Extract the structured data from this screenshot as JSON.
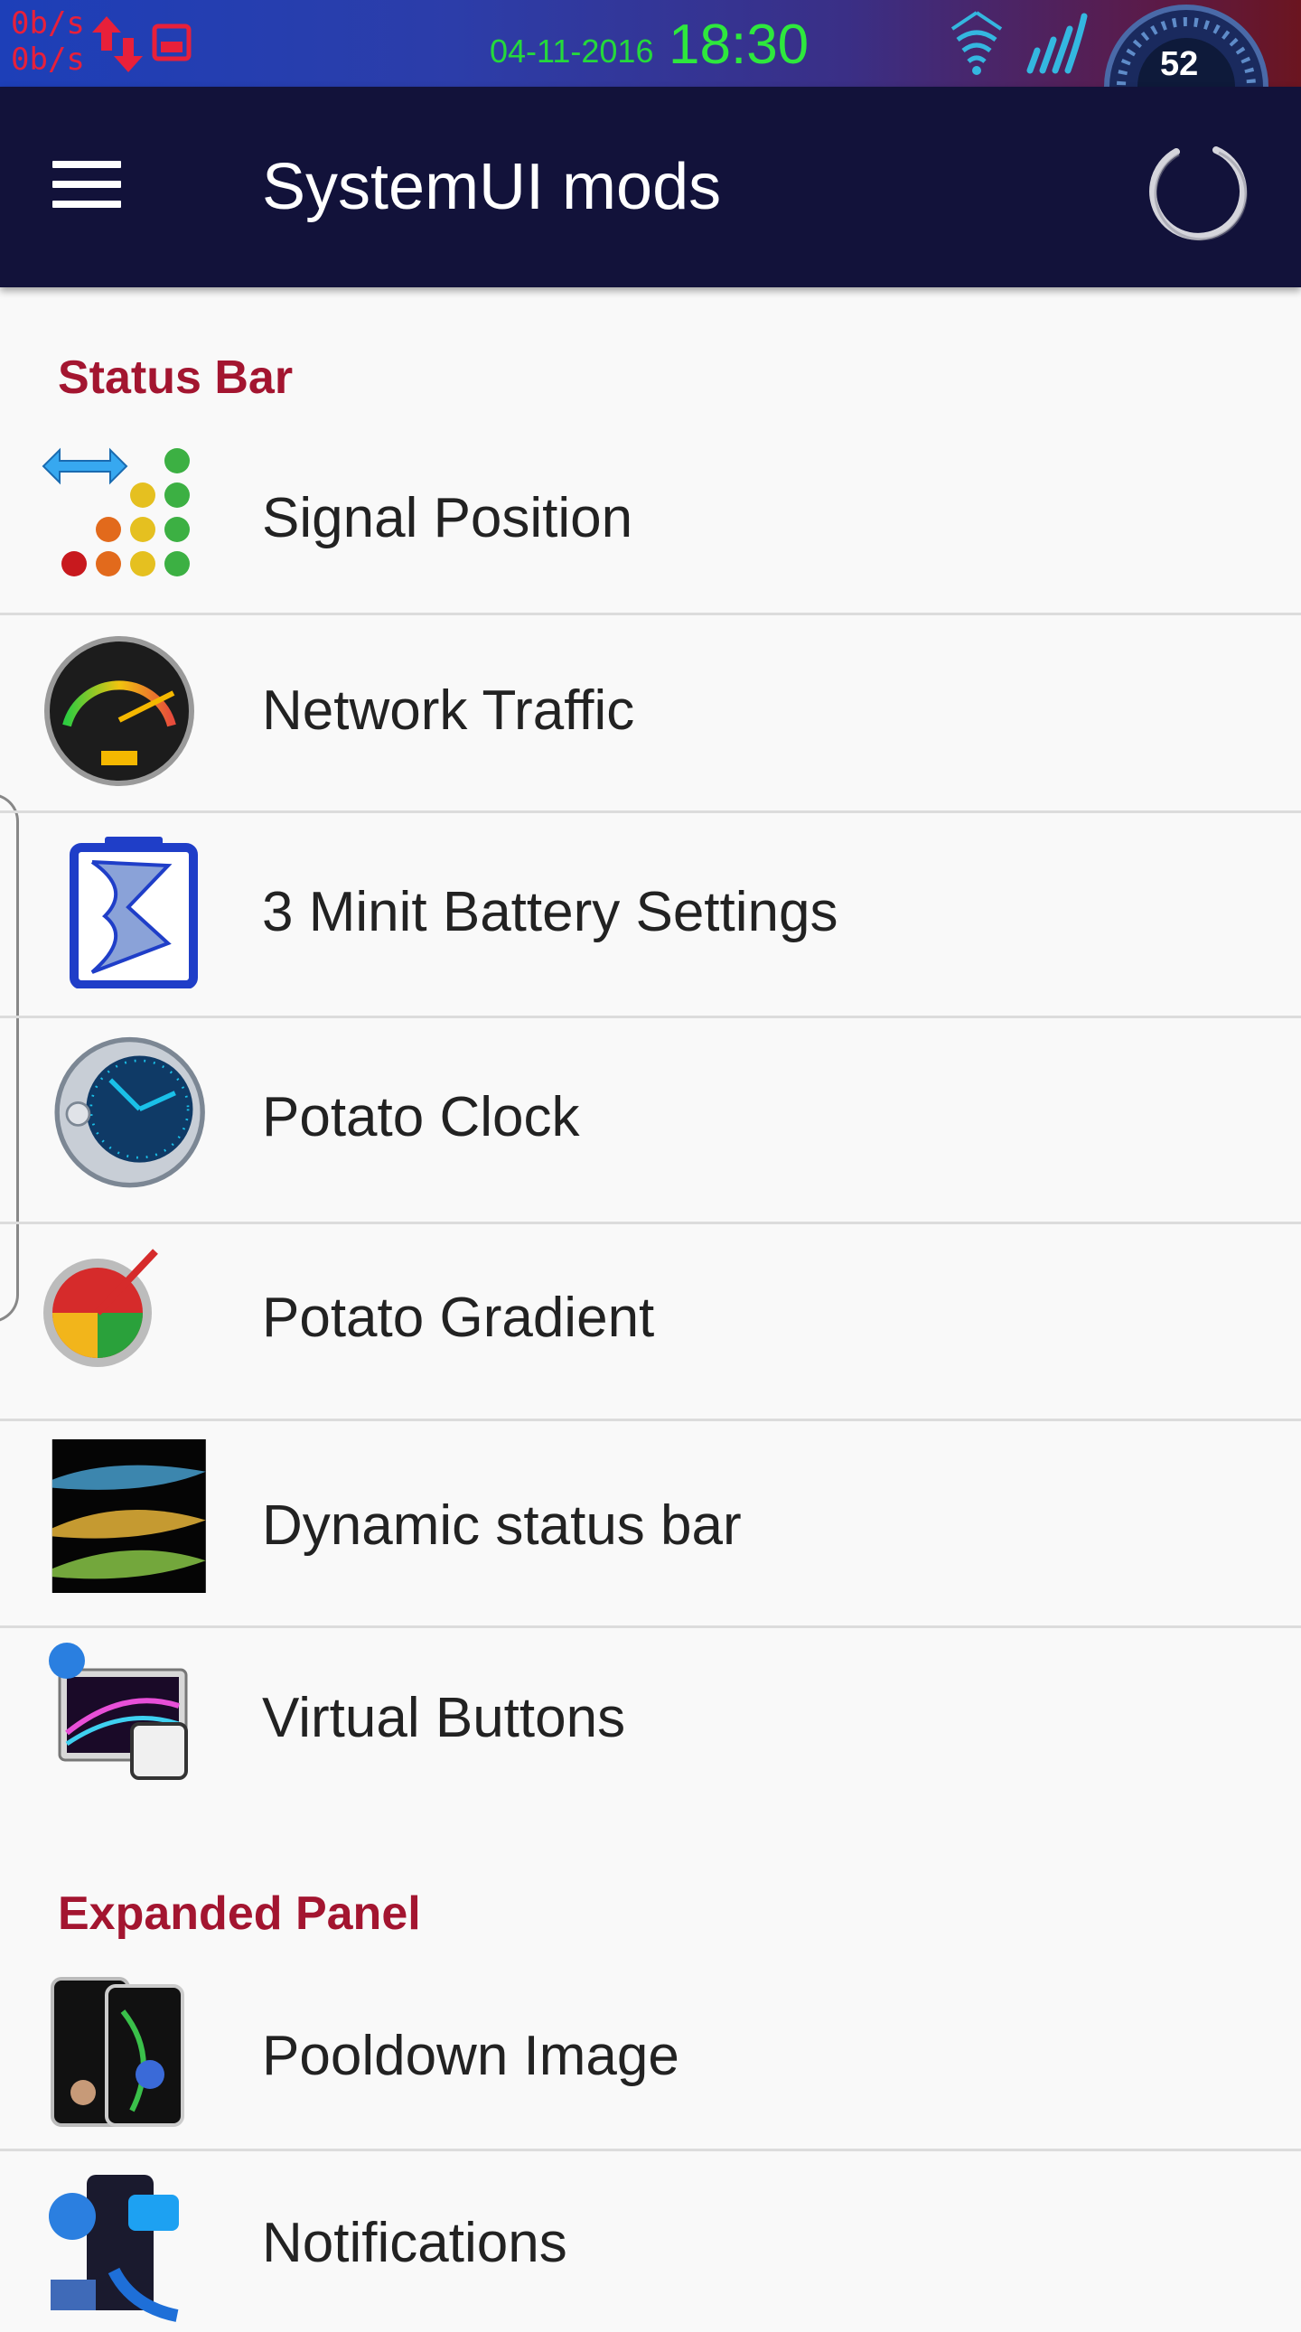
{
  "status_bar": {
    "net_up": "0b/s",
    "net_down": "0b/s",
    "date": "04-11-2016",
    "time": "18:30",
    "battery_level": "52",
    "icons": [
      "network-traffic-arrows-icon",
      "screenshot-icon",
      "wifi-icon",
      "signal-icon",
      "battery-gauge-icon"
    ]
  },
  "app_bar": {
    "title": "SystemUI mods",
    "menu_icon": "hamburger-menu-icon",
    "refresh_icon": "refresh-icon"
  },
  "sections": [
    {
      "header": "Status Bar",
      "items": [
        {
          "label": "Signal Position",
          "icon": "signal-position-icon"
        },
        {
          "label": "Network Traffic",
          "icon": "network-traffic-icon"
        },
        {
          "label": "3 Minit Battery Settings",
          "icon": "battery-settings-icon"
        },
        {
          "label": "Potato Clock",
          "icon": "clock-icon"
        },
        {
          "label": "Potato Gradient",
          "icon": "gradient-icon"
        },
        {
          "label": "Dynamic status bar",
          "icon": "dynamic-status-bar-icon"
        },
        {
          "label": "Virtual Buttons",
          "icon": "virtual-buttons-icon"
        }
      ]
    },
    {
      "header": "Expanded Panel",
      "items": [
        {
          "label": "Pooldown Image",
          "icon": "phone-image-icon"
        },
        {
          "label": "Notifications",
          "icon": "notifications-icon"
        }
      ]
    }
  ],
  "colors": {
    "app_bar": "#12123a",
    "section_header": "#a31530",
    "clock_green": "#2ee83d",
    "background": "#f9f9f9"
  }
}
